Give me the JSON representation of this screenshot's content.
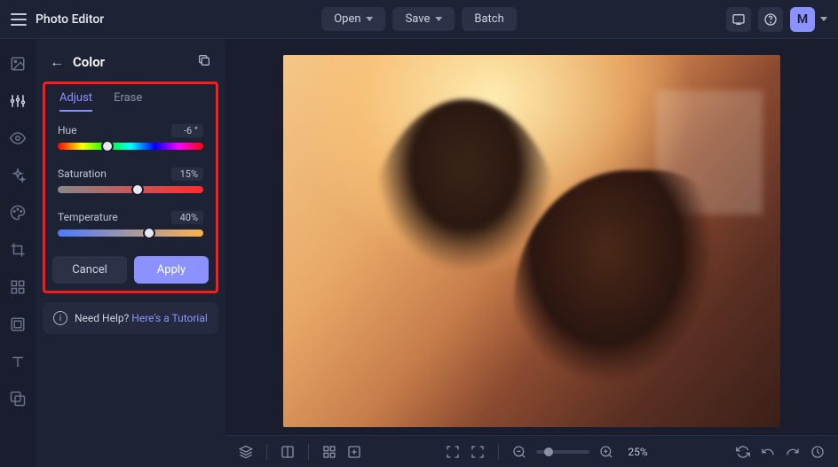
{
  "app_title": "Photo Editor",
  "topbar": {
    "open_label": "Open",
    "save_label": "Save",
    "batch_label": "Batch",
    "avatar_initial": "M"
  },
  "panel": {
    "title": "Color",
    "tabs": {
      "adjust": "Adjust",
      "erase": "Erase"
    },
    "hue": {
      "label": "Hue",
      "value": "-6 °",
      "thumb_pct": 34
    },
    "saturation": {
      "label": "Saturation",
      "value": "15%",
      "thumb_pct": 55
    },
    "temperature": {
      "label": "Temperature",
      "value": "40%",
      "thumb_pct": 63
    },
    "cancel_label": "Cancel",
    "apply_label": "Apply"
  },
  "help": {
    "prefix": "Need Help? ",
    "link": "Here's a Tutorial"
  },
  "bottom": {
    "zoom_value": "25%"
  }
}
